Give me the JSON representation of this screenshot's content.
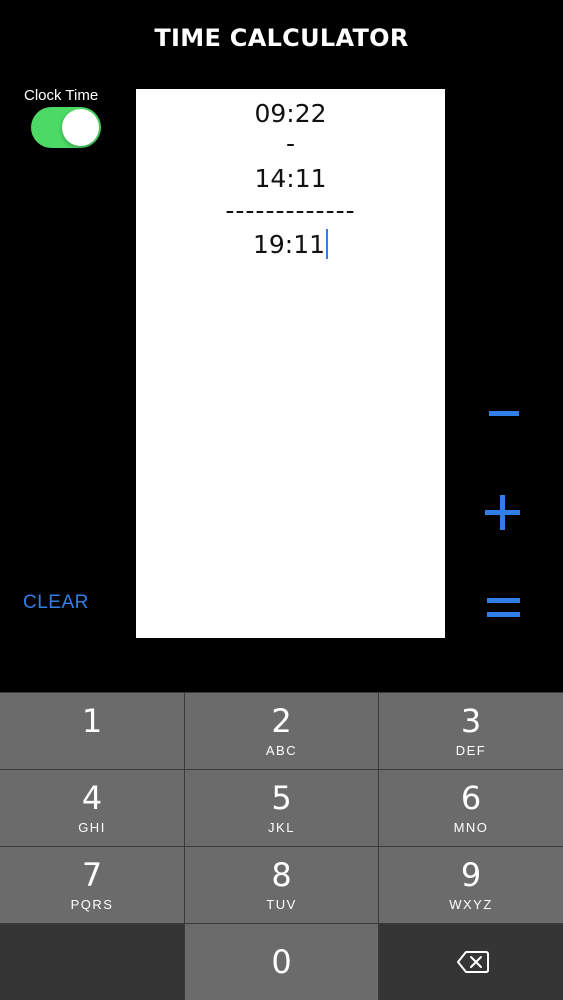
{
  "header": {
    "title": "TIME CALCULATOR"
  },
  "toggle": {
    "label": "Clock Time",
    "on": true,
    "color": "#4cd964"
  },
  "actions": {
    "clear_label": "CLEAR",
    "accent_color": "#2f7fe6"
  },
  "paper": {
    "line1": "09:22",
    "operator": "-",
    "line2": "14:11",
    "separator": "-------------",
    "result": "19:11"
  },
  "operators": {
    "minus": "minus-icon",
    "plus": "plus-icon",
    "equals": "equals-icon"
  },
  "keypad": {
    "keys": [
      {
        "num": "1",
        "letters": ""
      },
      {
        "num": "2",
        "letters": "ABC"
      },
      {
        "num": "3",
        "letters": "DEF"
      },
      {
        "num": "4",
        "letters": "GHI"
      },
      {
        "num": "5",
        "letters": "JKL"
      },
      {
        "num": "6",
        "letters": "MNO"
      },
      {
        "num": "7",
        "letters": "PQRS"
      },
      {
        "num": "8",
        "letters": "TUV"
      },
      {
        "num": "9",
        "letters": "WXYZ"
      },
      {
        "num": "0",
        "letters": ""
      }
    ],
    "delete_icon": "backspace-icon"
  }
}
